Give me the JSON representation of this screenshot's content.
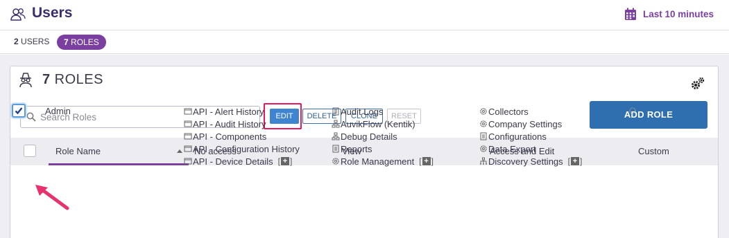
{
  "header": {
    "title": "Users",
    "time_range_label": "Last 10 minutes"
  },
  "tabs": {
    "users": {
      "count": "2",
      "label": "USERS"
    },
    "roles": {
      "count": "7",
      "label": "ROLES"
    }
  },
  "panel": {
    "count": "7",
    "title": "ROLES",
    "search_placeholder": "Search Roles",
    "buttons": {
      "edit": "EDIT",
      "delete": "DELETE",
      "clone": "CLONE",
      "reset": "RESET",
      "add_role": "ADD ROLE"
    }
  },
  "table": {
    "columns": {
      "role_name": "Role Name",
      "no_access": "No access",
      "view": "View",
      "access_edit": "Access and Edit",
      "custom": "Custom"
    },
    "rows": [
      {
        "role_name": "Admin",
        "checked": true,
        "no_access": [
          "API - Alert History",
          "API - Audit History",
          "API - Components",
          "API - Configuration History",
          "API - Device Details"
        ],
        "view": [
          "Audit Logs",
          "AuvikFlow (Kentik)",
          "Debug Details",
          "Reports",
          "Role Management"
        ],
        "access_edit": [
          "Collectors",
          "Company Settings",
          "Configurations",
          "Data Export",
          "Discovery Settings"
        ]
      }
    ]
  },
  "colors": {
    "accent_purple": "#7b3fa0",
    "title_navy": "#3b2d6e",
    "primary_blue": "#2f6fb0",
    "highlight_pink": "#e8175d"
  }
}
